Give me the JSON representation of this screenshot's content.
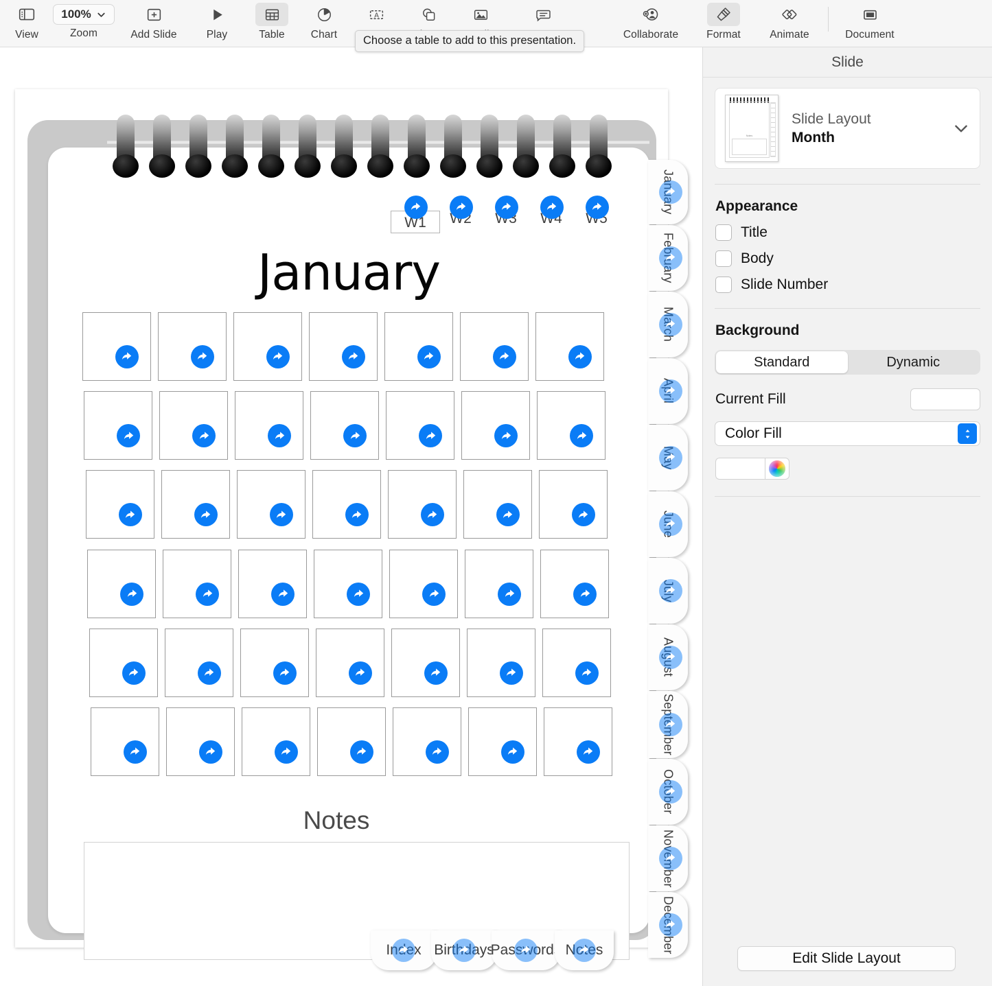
{
  "toolbar": {
    "items": [
      {
        "label": "View",
        "icon": "sidebar-icon",
        "selected": false,
        "type": "icon"
      },
      {
        "label": "Zoom",
        "icon": "zoom-chevron-icon",
        "selected": false,
        "type": "zoom",
        "value": "100%"
      },
      {
        "label": "Add Slide",
        "icon": "add-slide-icon",
        "selected": false,
        "type": "icon"
      },
      {
        "label": "Play",
        "icon": "play-icon",
        "selected": false,
        "type": "icon"
      },
      {
        "label": "Table",
        "icon": "table-icon",
        "selected": true,
        "type": "icon"
      },
      {
        "label": "Chart",
        "icon": "chart-pie-icon",
        "selected": false,
        "type": "icon"
      },
      {
        "label": "Text",
        "icon": "text-box-icon",
        "selected": false,
        "type": "icon"
      },
      {
        "label": "Shape",
        "icon": "shape-icon",
        "selected": false,
        "type": "icon"
      },
      {
        "label": "Media",
        "icon": "media-image-icon",
        "selected": false,
        "type": "icon"
      },
      {
        "label": "Comment",
        "icon": "comment-icon",
        "selected": false,
        "type": "icon"
      },
      {
        "label": "Collaborate",
        "icon": "collaborate-icon",
        "selected": false,
        "type": "icon"
      },
      {
        "label": "Format",
        "icon": "format-brush-icon",
        "selected": true,
        "type": "icon"
      },
      {
        "label": "Animate",
        "icon": "animate-icon",
        "selected": false,
        "type": "icon"
      },
      {
        "label": "Document",
        "icon": "document-icon",
        "selected": false,
        "type": "icon"
      }
    ],
    "tooltip": "Choose a table to add to this presentation."
  },
  "slide": {
    "month_title": "January",
    "week_headers": [
      "W1",
      "W2",
      "W3",
      "W4",
      "W5"
    ],
    "notes_label": "Notes",
    "notes_value": "",
    "grid_rows": 6,
    "grid_cols": 7,
    "month_tabs": [
      "January",
      "February",
      "March",
      "April",
      "May",
      "June",
      "July",
      "August",
      "September",
      "October",
      "November",
      "December"
    ],
    "bottom_tabs": [
      "Index",
      "Birthdays",
      "Passwords",
      "Notes"
    ],
    "share_icon_name": "share-arrow-icon",
    "accent_color": "#0a7cf6"
  },
  "sidebar": {
    "header": "Slide",
    "layout": {
      "label": "Slide Layout",
      "value": "Month",
      "thumb_notes_label": "Notes"
    },
    "appearance": {
      "title": "Appearance",
      "checkboxes": [
        {
          "label": "Title",
          "checked": false
        },
        {
          "label": "Body",
          "checked": false
        },
        {
          "label": "Slide Number",
          "checked": false
        }
      ]
    },
    "background": {
      "title": "Background",
      "segments": [
        {
          "label": "Standard",
          "active": true
        },
        {
          "label": "Dynamic",
          "active": false
        }
      ],
      "current_fill_label": "Current Fill",
      "current_fill_value": "",
      "fill_type": "Color Fill",
      "color_value": "#ffffff"
    },
    "edit_layout_button": "Edit Slide Layout"
  }
}
